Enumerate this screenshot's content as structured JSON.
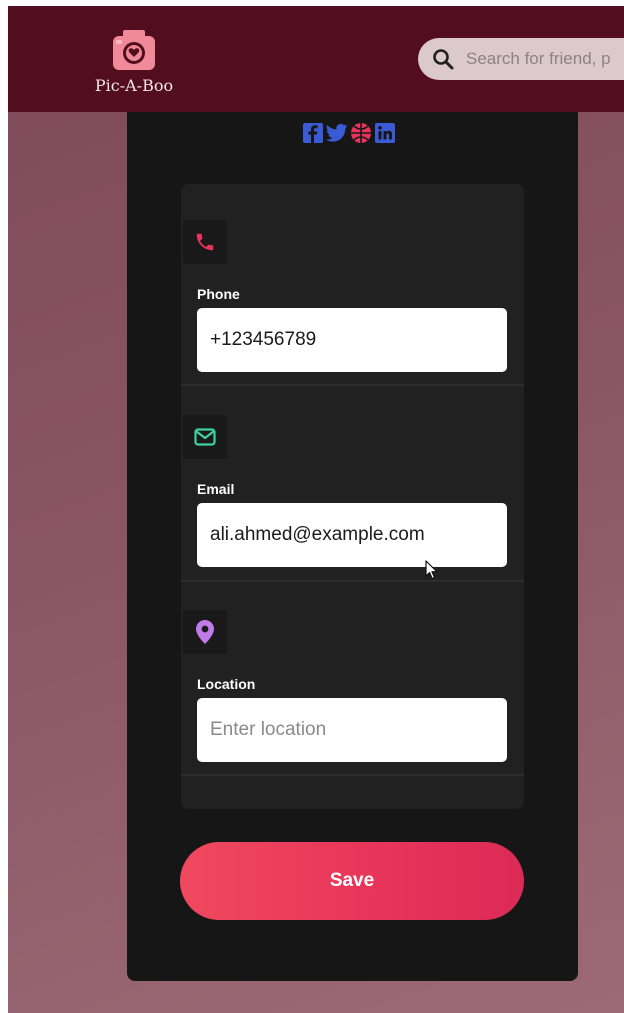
{
  "app": {
    "brand_name": "Pic-A-Boo"
  },
  "search": {
    "placeholder": "Search for friend, p"
  },
  "social": {
    "icons": [
      "facebook-icon",
      "twitter-icon",
      "dribbble-icon",
      "linkedin-icon"
    ],
    "linkedin_glyph": "in",
    "facebook_glyph": "f"
  },
  "contact": {
    "phone": {
      "label": "Phone",
      "value": "+123456789",
      "icon": "phone-icon",
      "icon_color": "#e8335a"
    },
    "email": {
      "label": "Email",
      "value": "ali.ahmed@example.com",
      "icon": "mail-icon",
      "icon_color": "#3fd1a0"
    },
    "location": {
      "label": "Location",
      "value": "",
      "placeholder": "Enter location",
      "icon": "location-pin-icon",
      "icon_color": "#c07be8"
    }
  },
  "actions": {
    "save_label": "Save"
  },
  "colors": {
    "header": "#520d1f",
    "card": "#171617",
    "panel": "#222122",
    "accent": "#e8355a",
    "social_blue": "#3b5bd6",
    "social_pink": "#e8335a"
  }
}
